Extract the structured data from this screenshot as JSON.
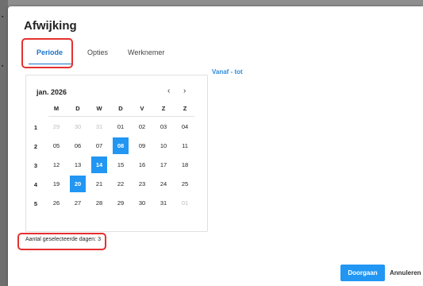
{
  "dialog": {
    "title": "Afwijking"
  },
  "tabs": [
    {
      "label": "Periode",
      "active": true
    },
    {
      "label": "Opties",
      "active": false
    },
    {
      "label": "Werknemer",
      "active": false
    }
  ],
  "calendar": {
    "month_label": "jan. 2026",
    "prev_glyph": "‹",
    "next_glyph": "›",
    "weekdays": [
      "M",
      "D",
      "W",
      "D",
      "V",
      "Z",
      "Z"
    ],
    "weeks": [
      {
        "num": "1",
        "days": [
          {
            "d": "29",
            "muted": true
          },
          {
            "d": "30",
            "muted": true
          },
          {
            "d": "31",
            "muted": true
          },
          {
            "d": "01"
          },
          {
            "d": "02"
          },
          {
            "d": "03"
          },
          {
            "d": "04"
          }
        ]
      },
      {
        "num": "2",
        "days": [
          {
            "d": "05"
          },
          {
            "d": "06"
          },
          {
            "d": "07"
          },
          {
            "d": "08",
            "selected": true
          },
          {
            "d": "09"
          },
          {
            "d": "10"
          },
          {
            "d": "11"
          }
        ]
      },
      {
        "num": "3",
        "days": [
          {
            "d": "12"
          },
          {
            "d": "13"
          },
          {
            "d": "14",
            "selected": true
          },
          {
            "d": "15"
          },
          {
            "d": "16"
          },
          {
            "d": "17"
          },
          {
            "d": "18"
          }
        ]
      },
      {
        "num": "4",
        "days": [
          {
            "d": "19"
          },
          {
            "d": "20",
            "selected": true
          },
          {
            "d": "21"
          },
          {
            "d": "22"
          },
          {
            "d": "23"
          },
          {
            "d": "24"
          },
          {
            "d": "25"
          }
        ]
      },
      {
        "num": "5",
        "days": [
          {
            "d": "26"
          },
          {
            "d": "27"
          },
          {
            "d": "28"
          },
          {
            "d": "29"
          },
          {
            "d": "30"
          },
          {
            "d": "31"
          },
          {
            "d": "01",
            "muted": true
          }
        ]
      }
    ]
  },
  "range_label": "Vanaf - tot",
  "summary": "Aantal geselecteerde dagen: 3",
  "buttons": {
    "primary": "Doorgaan",
    "secondary": "Annuleren"
  },
  "colors": {
    "accent": "#2196f3",
    "highlight": "#e5312f",
    "link": "#2f8ad8"
  }
}
